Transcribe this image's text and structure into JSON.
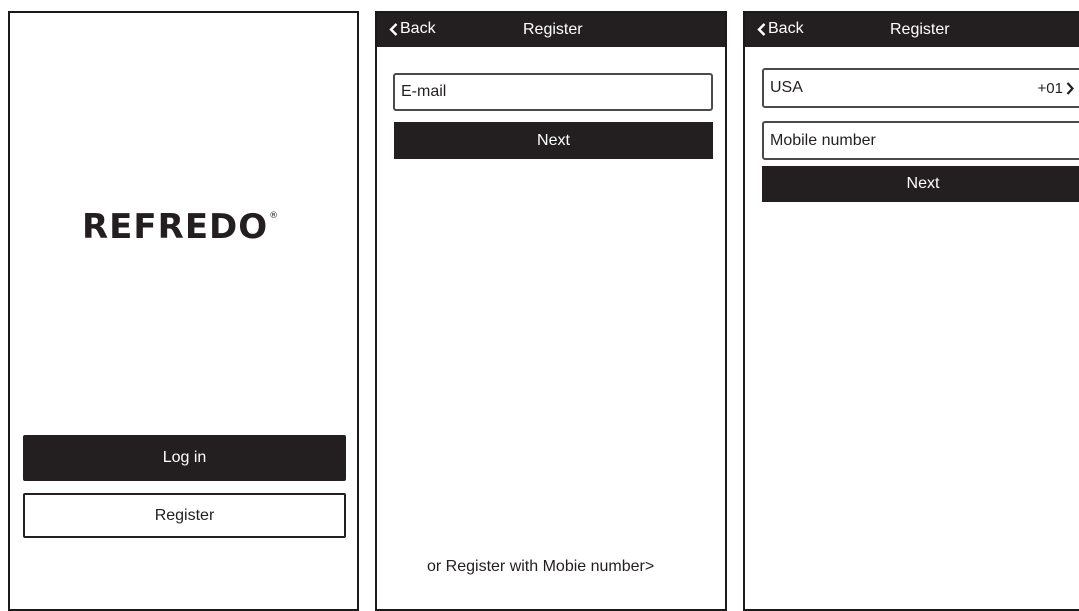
{
  "welcome_screen": {
    "logo": "REFREDO",
    "logo_mark": "®",
    "login_label": "Log in",
    "register_label": "Register"
  },
  "email_register_screen": {
    "back_label": "Back",
    "title": "Register",
    "email_placeholder": "E-mail",
    "next_label": "Next",
    "alt_link": "or Register with Mobie number>"
  },
  "mobile_register_screen": {
    "back_label": "Back",
    "title": "Register",
    "country": "USA",
    "country_code": "+01",
    "mobile_placeholder": "Mobile number",
    "next_label": "Next"
  },
  "icons": {
    "back": "chevron-left-icon",
    "country_select": "chevron-right-icon"
  },
  "colors": {
    "primary_dark": "#231f20",
    "background": "#ffffff"
  }
}
